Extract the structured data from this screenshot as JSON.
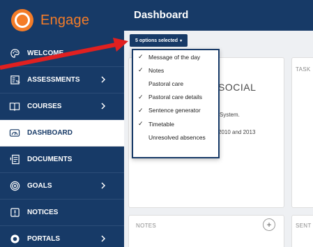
{
  "brand": {
    "name": "Engage"
  },
  "sidebar": {
    "items": [
      {
        "label": "WELCOME",
        "icon": "palette-icon",
        "chevron": false
      },
      {
        "label": "ASSESSMENTS",
        "icon": "grade-icon",
        "chevron": true
      },
      {
        "label": "COURSES",
        "icon": "book-icon",
        "chevron": true
      },
      {
        "label": "DASHBOARD",
        "icon": "dashboard-icon",
        "chevron": false,
        "active": true
      },
      {
        "label": "DOCUMENTS",
        "icon": "document-icon",
        "chevron": false
      },
      {
        "label": "GOALS",
        "icon": "target-icon",
        "chevron": true
      },
      {
        "label": "NOTICES",
        "icon": "notice-icon",
        "chevron": false
      },
      {
        "label": "PORTALS",
        "icon": "portal-icon",
        "chevron": true
      }
    ]
  },
  "header": {
    "title": "Dashboard"
  },
  "options_button": {
    "label": "5 options selected",
    "caret": "▾"
  },
  "dropdown": {
    "items": [
      {
        "label": "Message of the day",
        "checked": true
      },
      {
        "label": "Notes",
        "checked": true
      },
      {
        "label": "Pastoral care",
        "checked": false
      },
      {
        "label": "Pastoral care details",
        "checked": true
      },
      {
        "label": "Sentence generator",
        "checked": true
      },
      {
        "label": "Timetable",
        "checked": true
      },
      {
        "label": "Unresolved absences",
        "checked": false
      }
    ]
  },
  "cards": {
    "message": {
      "title": "SOCIAL",
      "line1": "System.",
      "line2": "2010 and 2013"
    },
    "tasks": {
      "header": "TASK"
    },
    "notes": {
      "header": "NOTES",
      "add": "+"
    },
    "sentence": {
      "header": "SENT"
    }
  },
  "colors": {
    "navy": "#173a67",
    "brand_orange": "#f47c28",
    "arrow_red": "#e02020"
  }
}
